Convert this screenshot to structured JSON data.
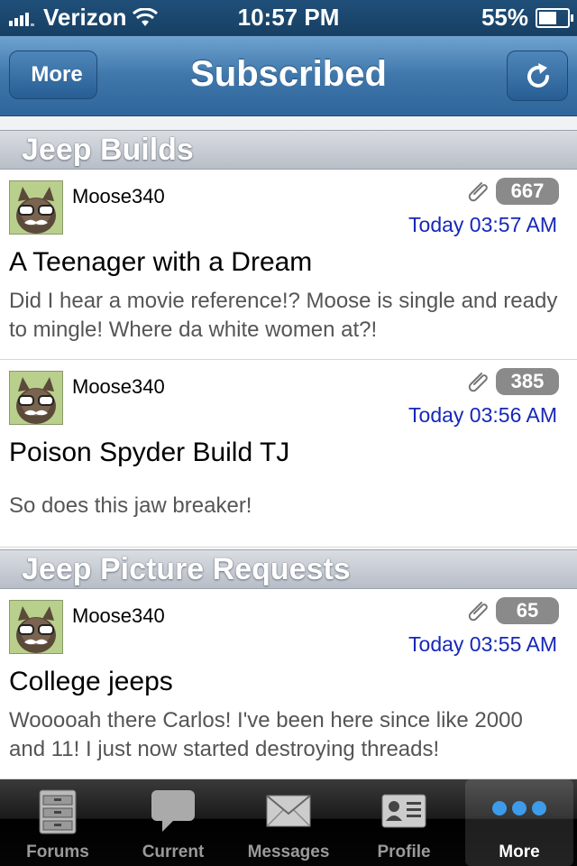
{
  "status_bar": {
    "carrier": "Verizon",
    "time": "10:57 PM",
    "battery": "55%"
  },
  "nav": {
    "back_label": "More",
    "title": "Subscribed"
  },
  "sections": [
    {
      "title": "Jeep Builds"
    },
    {
      "title": "Jeep Picture Requests"
    }
  ],
  "posts": [
    {
      "author": "Moose340",
      "count": "667",
      "date": "Today 03:57 AM",
      "title": "A Teenager with a Dream",
      "excerpt": "Did I hear a movie reference!? Moose is single and ready to mingle! Where da white women at?!"
    },
    {
      "author": "Moose340",
      "count": "385",
      "date": "Today 03:56 AM",
      "title": "Poison Spyder Build TJ",
      "excerpt": "So does this jaw breaker!"
    },
    {
      "author": "Moose340",
      "count": "65",
      "date": "Today 03:55 AM",
      "title": "College jeeps",
      "excerpt": "Wooooah there Carlos! I've been here since like 2000 and 11! I just now started destroying threads!"
    }
  ],
  "tabs": [
    {
      "label": "Forums",
      "icon": "cabinet-icon"
    },
    {
      "label": "Current",
      "icon": "speech-bubble-icon"
    },
    {
      "label": "Messages",
      "icon": "envelope-icon"
    },
    {
      "label": "Profile",
      "icon": "id-card-icon"
    },
    {
      "label": "More",
      "icon": "dots-icon",
      "active": true
    }
  ]
}
